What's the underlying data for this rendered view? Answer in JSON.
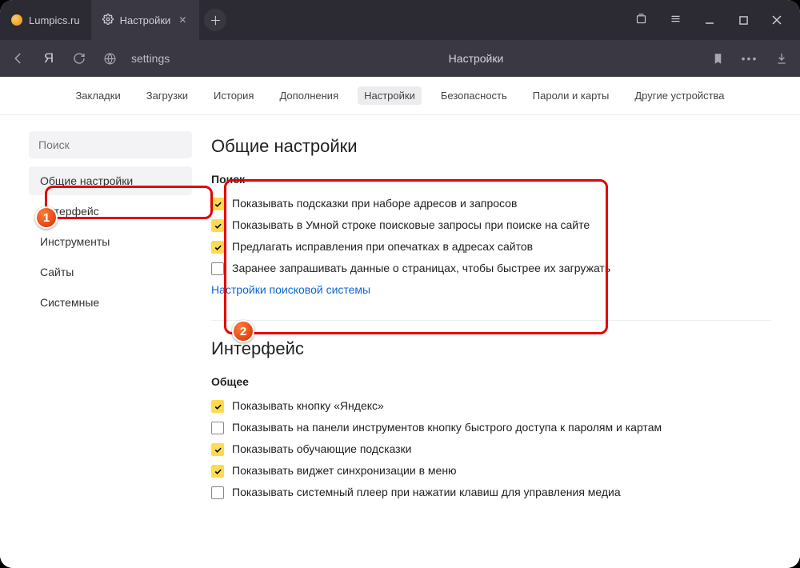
{
  "tabs": [
    {
      "label": "Lumpics.ru",
      "active": false
    },
    {
      "label": "Настройки",
      "active": true
    }
  ],
  "addressbar": {
    "url": "settings",
    "title": "Настройки"
  },
  "topnav": [
    "Закладки",
    "Загрузки",
    "История",
    "Дополнения",
    "Настройки",
    "Безопасность",
    "Пароли и карты",
    "Другие устройства"
  ],
  "topnav_active": 4,
  "sidebar": {
    "search_placeholder": "Поиск",
    "items": [
      "Общие настройки",
      "Интерфейс",
      "Инструменты",
      "Сайты",
      "Системные"
    ],
    "active": 0
  },
  "main": {
    "heading": "Общие настройки",
    "search_section": {
      "title": "Поиск",
      "options": [
        {
          "checked": true,
          "label": "Показывать подсказки при наборе адресов и запросов"
        },
        {
          "checked": true,
          "label": "Показывать в Умной строке поисковые запросы при поиске на сайте"
        },
        {
          "checked": true,
          "label": "Предлагать исправления при опечатках в адресах сайтов"
        },
        {
          "checked": false,
          "label": "Заранее запрашивать данные о страницах, чтобы быстрее их загружать"
        }
      ],
      "link": "Настройки поисковой системы"
    },
    "interface_heading": "Интерфейс",
    "general_section": {
      "title": "Общее",
      "options": [
        {
          "checked": true,
          "label": "Показывать кнопку «Яндекс»"
        },
        {
          "checked": false,
          "label": "Показывать на панели инструментов кнопку быстрого доступа к паролям и картам"
        },
        {
          "checked": true,
          "label": "Показывать обучающие подсказки"
        },
        {
          "checked": true,
          "label": "Показывать виджет синхронизации в меню"
        },
        {
          "checked": false,
          "label": "Показывать системный плеер при нажатии клавиш для управления медиа"
        }
      ]
    }
  },
  "badges": {
    "one": "1",
    "two": "2"
  }
}
